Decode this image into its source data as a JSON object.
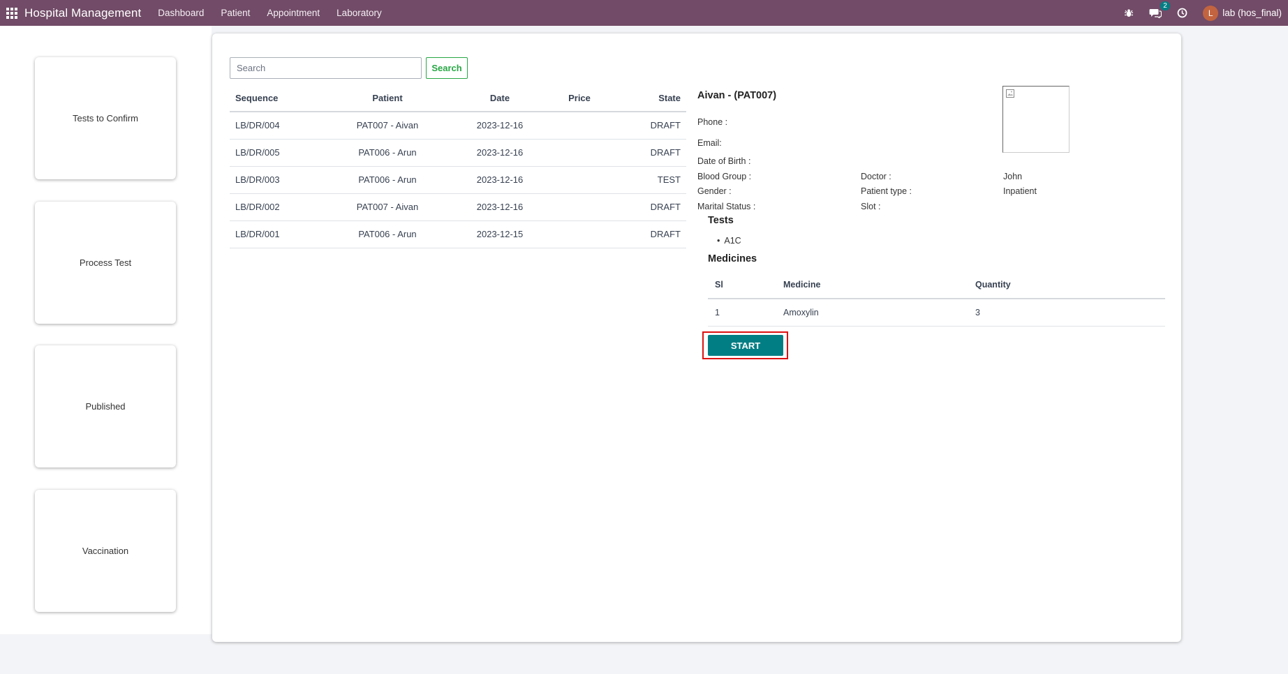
{
  "navbar": {
    "brand": "Hospital Management",
    "menu": [
      "Dashboard",
      "Patient",
      "Appointment",
      "Laboratory"
    ],
    "messages_count": "2",
    "user_initial": "L",
    "user_name": "lab (hos_final)",
    "color": "#714b67"
  },
  "tiles": [
    "Tests to Confirm",
    "Process Test",
    "Published",
    "Vaccination"
  ],
  "search": {
    "placeholder": "Search",
    "button": "Search"
  },
  "table": {
    "headers": [
      "Sequence",
      "Patient",
      "Date",
      "Price",
      "State"
    ],
    "rows": [
      [
        "LB/DR/004",
        "PAT007 - Aivan",
        "2023-12-16",
        "",
        "DRAFT"
      ],
      [
        "LB/DR/005",
        "PAT006 - Arun",
        "2023-12-16",
        "",
        "DRAFT"
      ],
      [
        "LB/DR/003",
        "PAT006 - Arun",
        "2023-12-16",
        "",
        "TEST"
      ],
      [
        "LB/DR/002",
        "PAT007 - Aivan",
        "2023-12-16",
        "",
        "DRAFT"
      ],
      [
        "LB/DR/001",
        "PAT006 - Arun",
        "2023-12-15",
        "",
        "DRAFT"
      ]
    ]
  },
  "detail": {
    "patient_title": "Aivan - (PAT007)",
    "phone_label": "Phone :",
    "email_label": "Email:",
    "dob_label": "Date of Birth :",
    "blood_group_label": "Blood Group :",
    "gender_label": "Gender :",
    "marital_label": "Marital Status :",
    "doctor_label": "Doctor :",
    "doctor_value": "John",
    "patient_type_label": "Patient type :",
    "patient_type_value": "Inpatient",
    "slot_label": "Slot :",
    "tests_title": "Tests",
    "tests": [
      "A1C"
    ],
    "medicines_title": "Medicines",
    "medicine_headers": [
      "Sl",
      "Medicine",
      "Quantity"
    ],
    "medicines": [
      [
        "1",
        "Amoxylin",
        "3"
      ]
    ],
    "start_button": "START",
    "accent_color": "#017e84"
  }
}
